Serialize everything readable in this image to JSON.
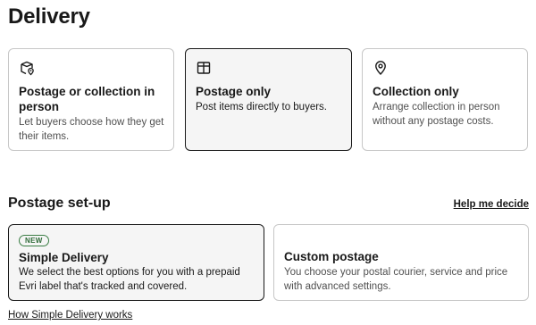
{
  "page": {
    "title": "Delivery"
  },
  "delivery_options": [
    {
      "icon": "parcel-location-icon",
      "title": "Postage or collection in person",
      "desc": "Let buyers choose how they get their items."
    },
    {
      "icon": "box-icon",
      "title": "Postage only",
      "desc": "Post items directly to buyers.",
      "selected": true
    },
    {
      "icon": "location-pin-icon",
      "title": "Collection only",
      "desc": "Arrange collection in person without any postage costs."
    }
  ],
  "postage_setup": {
    "heading": "Postage set-up",
    "help_link": "Help me decide",
    "options": [
      {
        "badge": "NEW",
        "title": "Simple Delivery",
        "desc": "We select the best options for you with a prepaid Evri label that's tracked and covered.",
        "selected": true
      },
      {
        "title": "Custom postage",
        "desc": "You choose your postal courier, service and price with advanced settings."
      }
    ],
    "footer_link": "How Simple Delivery works"
  }
}
